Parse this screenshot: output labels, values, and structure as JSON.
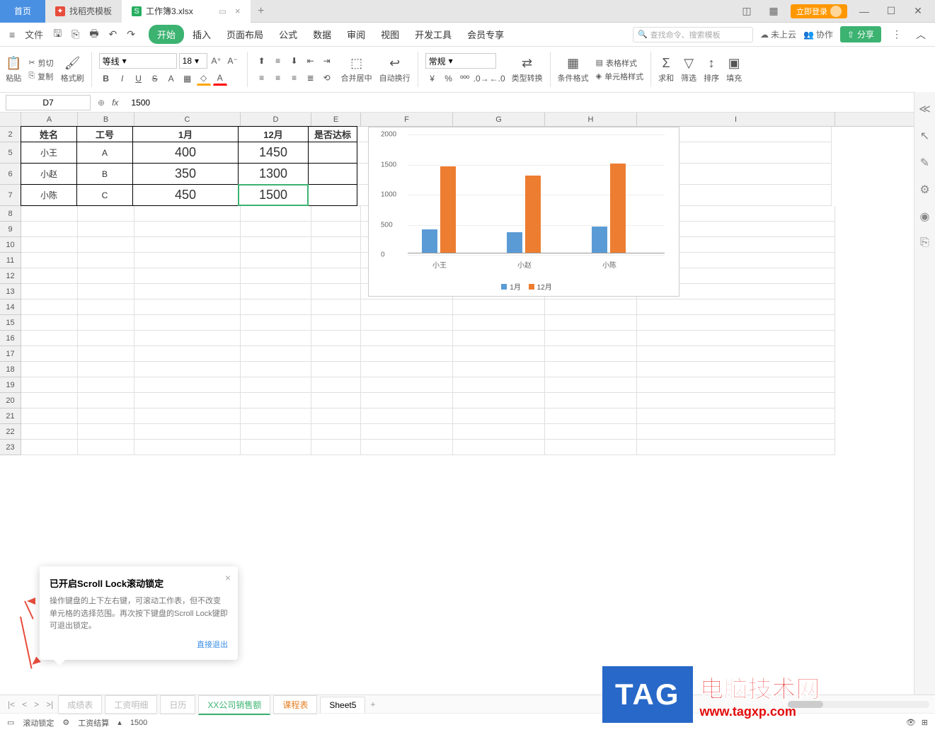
{
  "tabs": {
    "home": "首页",
    "template": "找稻壳模板",
    "workbook": "工作簿3.xlsx"
  },
  "window": {
    "login": "立即登录"
  },
  "menu": {
    "file": "文件",
    "items": [
      "开始",
      "插入",
      "页面布局",
      "公式",
      "数据",
      "审阅",
      "视图",
      "开发工具",
      "会员专享"
    ],
    "search_placeholder": "查找命令、搜索模板",
    "cloud": "未上云",
    "collab": "协作",
    "share": "分享"
  },
  "ribbon": {
    "paste": "粘贴",
    "cut": "剪切",
    "copy": "复制",
    "format_painter": "格式刷",
    "font_name": "等线",
    "font_size": "18",
    "merge": "合并居中",
    "wrap": "自动换行",
    "number_format": "常规",
    "type_convert": "类型转换",
    "cond_format": "条件格式",
    "table_style": "表格样式",
    "cell_style": "单元格样式",
    "sum": "求和",
    "filter": "筛选",
    "sort": "排序",
    "fill": "填充"
  },
  "formula_bar": {
    "cell_ref": "D7",
    "value": "1500"
  },
  "columns": [
    "A",
    "B",
    "C",
    "D",
    "E",
    "F",
    "G",
    "H",
    "I"
  ],
  "rows": [
    "2",
    "5",
    "6",
    "7",
    "8",
    "9",
    "10",
    "11",
    "12",
    "13",
    "14",
    "15",
    "16",
    "17",
    "18",
    "19",
    "20",
    "21",
    "22",
    "23"
  ],
  "table": {
    "headers": [
      "姓名",
      "工号",
      "1月",
      "12月",
      "是否达标"
    ],
    "rows": [
      {
        "name": "小王",
        "id": "A",
        "m1": "400",
        "m12": "1450"
      },
      {
        "name": "小赵",
        "id": "B",
        "m1": "350",
        "m12": "1300"
      },
      {
        "name": "小陈",
        "id": "C",
        "m1": "450",
        "m12": "1500"
      }
    ]
  },
  "chart_data": {
    "type": "bar",
    "categories": [
      "小王",
      "小赵",
      "小陈"
    ],
    "series": [
      {
        "name": "1月",
        "values": [
          400,
          350,
          450
        ],
        "color": "#5b9bd5"
      },
      {
        "name": "12月",
        "values": [
          1450,
          1300,
          1500
        ],
        "color": "#ed7d31"
      }
    ],
    "ylim": [
      0,
      2000
    ],
    "yticks": [
      0,
      500,
      1000,
      1500,
      2000
    ]
  },
  "popup": {
    "title": "已开启Scroll Lock滚动锁定",
    "body": "操作键盘的上下左右键，可滚动工作表，但不改变单元格的选择范围。再次按下键盘的Scroll Lock键即可退出锁定。",
    "link": "直接退出"
  },
  "sheets": {
    "faded": [
      "成绩表",
      "工资明细",
      "日历"
    ],
    "active": "XX公司销售额",
    "tabs": [
      "课程表",
      "Sheet5"
    ]
  },
  "status": {
    "scroll_lock": "滚动锁定",
    "calc": "工资结算",
    "value": "1500"
  },
  "watermark": {
    "tag": "TAG",
    "line1": "电脑技术网",
    "line2": "www.tagxp.com"
  }
}
